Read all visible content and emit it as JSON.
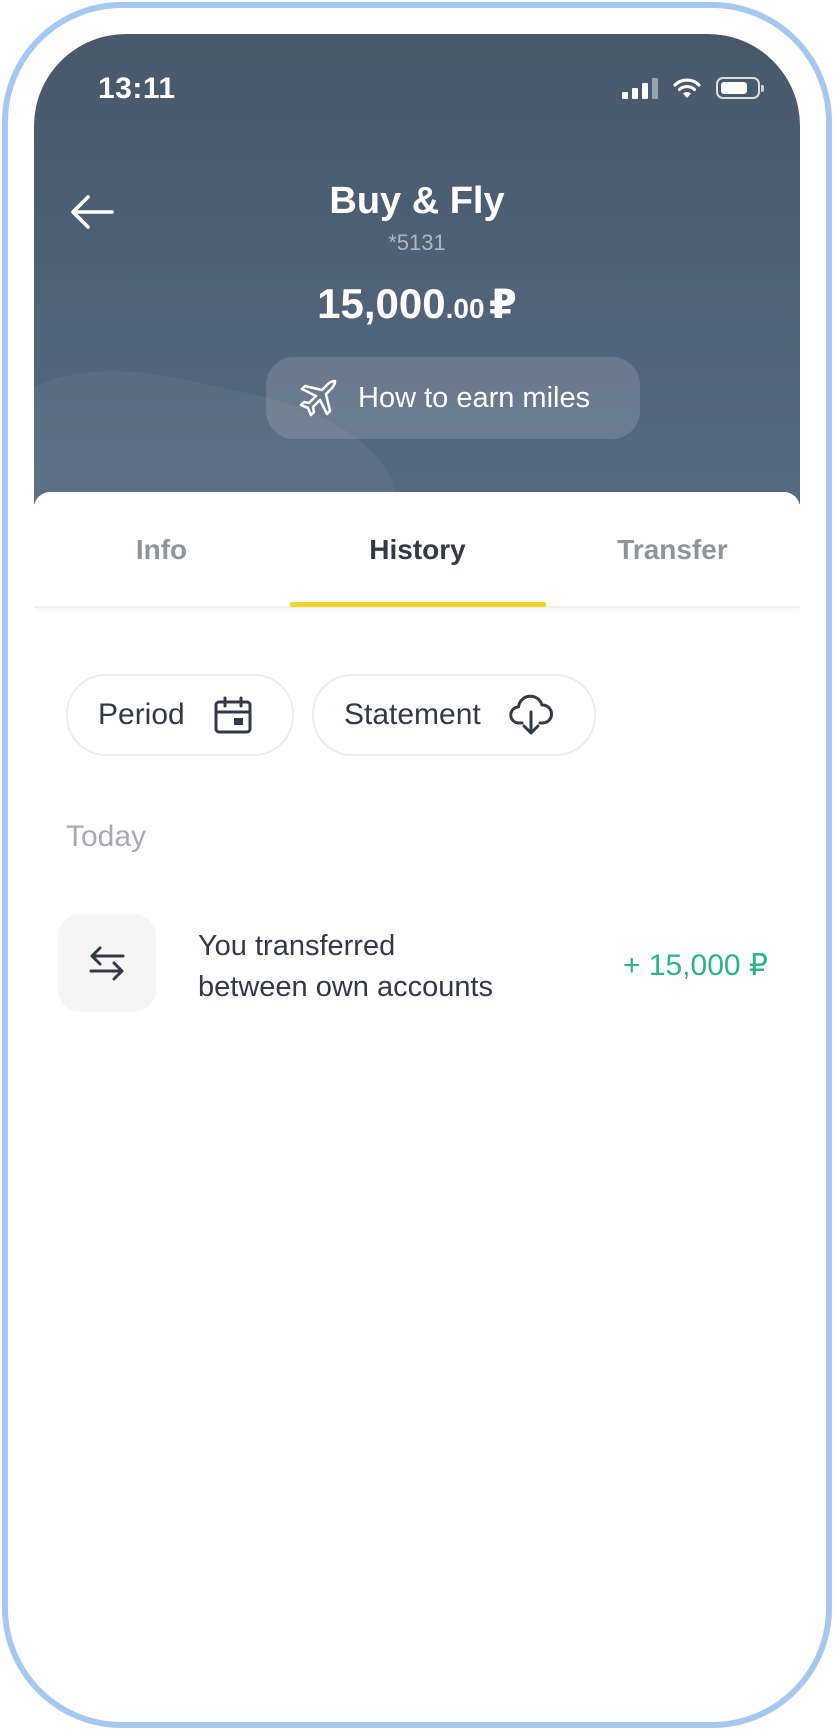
{
  "status_bar": {
    "time": "13:11",
    "icons": [
      "signal-icon",
      "wifi-icon",
      "battery-icon"
    ]
  },
  "header": {
    "title": "Buy & Fly",
    "account_number": "*5131",
    "balance_integer": "15,000",
    "balance_decimal": ".00",
    "balance_currency": "₽",
    "earn_button_label": "How to earn miles",
    "earn_button_icon": "airplane-icon",
    "back_icon": "arrow-left-icon"
  },
  "tabs": [
    {
      "label": "Info",
      "active": false
    },
    {
      "label": "History",
      "active": true
    },
    {
      "label": "Transfer",
      "active": false
    }
  ],
  "filters": {
    "period_label": "Period",
    "period_icon": "calendar-icon",
    "statement_label": "Statement",
    "statement_icon": "cloud-download-icon"
  },
  "history": {
    "group_label": "Today",
    "items": [
      {
        "line1": "You transferred",
        "line2": "between own accounts",
        "amount": "+ 15,000 ₽",
        "icon": "transfer-arrows-icon"
      }
    ]
  },
  "colors": {
    "header_bg": "#4f6276",
    "accent_tab": "#f5d428",
    "amount_positive": "#2ab38e",
    "frame_outline": "#a6c8f0"
  }
}
